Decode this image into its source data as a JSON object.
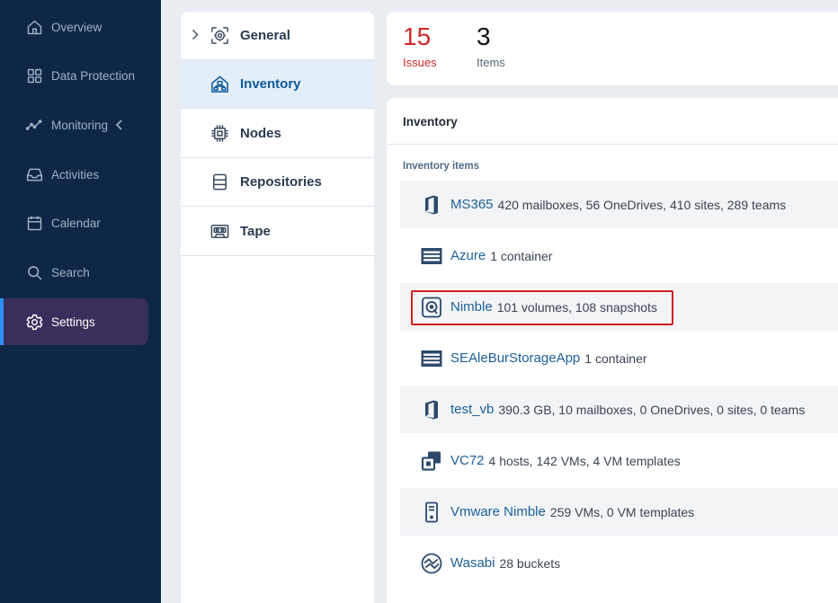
{
  "nav": {
    "items": [
      {
        "label": "Overview",
        "icon": "home-icon"
      },
      {
        "label": "Data Protection",
        "icon": "grid-icon"
      },
      {
        "label": "Monitoring",
        "icon": "trend-icon"
      },
      {
        "label": "Activities",
        "icon": "inbox-icon"
      },
      {
        "label": "Calendar",
        "icon": "calendar-icon"
      },
      {
        "label": "Search",
        "icon": "search-icon"
      },
      {
        "label": "Settings",
        "icon": "gear-icon"
      }
    ],
    "active": "Settings"
  },
  "settings_menu": {
    "items": [
      {
        "label": "General",
        "icon": "gear-box-icon"
      },
      {
        "label": "Inventory",
        "icon": "house-network-icon"
      },
      {
        "label": "Nodes",
        "icon": "chip-icon"
      },
      {
        "label": "Repositories",
        "icon": "database-icon"
      },
      {
        "label": "Tape",
        "icon": "tape-icon"
      }
    ],
    "active": "Inventory"
  },
  "summary": {
    "issues_count": "15",
    "issues_label": "Issues",
    "items_count": "3",
    "items_label": "Items"
  },
  "inventory": {
    "title": "Inventory",
    "section_label": "Inventory items",
    "items": [
      {
        "name": "MS365",
        "detail": "420 mailboxes, 56 OneDrives, 410 sites, 289 teams",
        "icon": "office-icon"
      },
      {
        "name": "Azure",
        "detail": "1 container",
        "icon": "storage-container-icon"
      },
      {
        "name": "Nimble",
        "detail": "101 volumes, 108 snapshots",
        "icon": "nimble-storage-icon"
      },
      {
        "name": "SEAleBurStorageApp",
        "detail": "1 container",
        "icon": "storage-container-icon"
      },
      {
        "name": "test_vb",
        "detail": "390.3 GB, 10 mailboxes, 0 OneDrives, 0 sites, 0 teams",
        "icon": "office-icon"
      },
      {
        "name": "VC72",
        "detail": "4 hosts, 142 VMs, 4 VM templates",
        "icon": "vcenter-icon"
      },
      {
        "name": "Vmware Nimble",
        "detail": "259 VMs, 0 VM templates",
        "icon": "esxi-host-icon"
      },
      {
        "name": "Wasabi",
        "detail": "28 buckets",
        "icon": "wasabi-icon"
      }
    ]
  },
  "colors": {
    "nav_bg": "#0e2746",
    "nav_active_bg": "#3a2e5c",
    "accent": "#2f8ef5",
    "issues_red": "#d12a2a",
    "link_blue": "#1d5f99",
    "highlight_red": "#d21f1f"
  }
}
